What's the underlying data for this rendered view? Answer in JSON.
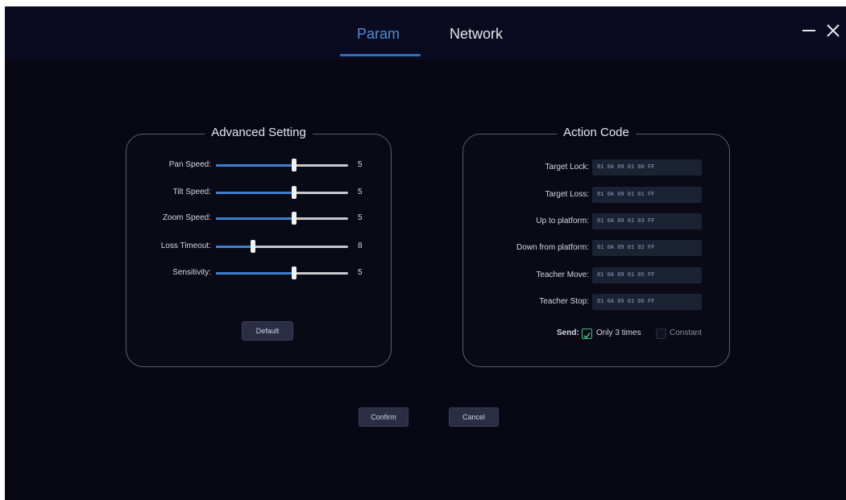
{
  "tabs": [
    {
      "label": "Param",
      "active": true
    },
    {
      "label": "Network",
      "active": false
    }
  ],
  "window": {
    "minimize_icon": "minus-icon",
    "close_icon": "close-icon"
  },
  "advanced": {
    "title": "Advanced Setting",
    "sliders": [
      {
        "label": "Pan Speed:",
        "value": "5",
        "level": 0.59
      },
      {
        "label": "Tilt Speed:",
        "value": "5",
        "level": 0.59
      },
      {
        "label": "Zoom Speed:",
        "value": "5",
        "level": 0.59
      },
      {
        "label": "Loss Timeout:",
        "value": "8",
        "level": 0.28
      },
      {
        "label": "Sensitivity:",
        "value": "5",
        "level": 0.59
      }
    ],
    "default_label": "Default"
  },
  "action": {
    "title": "Action Code",
    "codes": [
      {
        "label": "Target Lock:",
        "value": "81 0A 09 01 00 FF"
      },
      {
        "label": "Target Loss:",
        "value": "81 0A 09 01 01 FF"
      },
      {
        "label": "Up to platform:",
        "value": "81 0A 09 01 03 FF"
      },
      {
        "label": "Down from platform:",
        "value": "81 0A 09 01 02 FF"
      },
      {
        "label": "Teacher Move:",
        "value": "81 0A 09 01 05 FF"
      },
      {
        "label": "Teacher Stop:",
        "value": "81 0A 09 01 06 FF"
      }
    ],
    "send_label": "Send:",
    "only3_label": "Only 3 times",
    "constant_label": "Constant"
  },
  "footer": {
    "confirm_label": "Confirm",
    "cancel_label": "Cancel"
  },
  "colors": {
    "accent": "#4d8fd6",
    "background": "#070814",
    "slider_fill": "#3d7fcf",
    "check": "#3fbf7f"
  }
}
